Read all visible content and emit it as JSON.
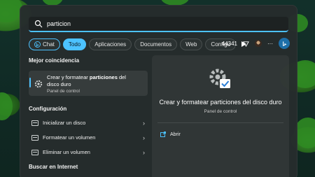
{
  "search": {
    "value": "particion"
  },
  "tabs": [
    {
      "label": "Chat",
      "icon": "bing-icon"
    },
    {
      "label": "Todo",
      "active": true
    },
    {
      "label": "Aplicaciones"
    },
    {
      "label": "Documentos"
    },
    {
      "label": "Web"
    },
    {
      "label": "Configu"
    }
  ],
  "toolbar": {
    "points": "44341",
    "more_label": "···"
  },
  "best_match": {
    "section": "Mejor coincidencia",
    "title_prefix": "Crear y formatear ",
    "title_bold": "particiones",
    "title_suffix": " del disco duro",
    "subtitle": "Panel de control"
  },
  "config": {
    "section": "Configuración",
    "items": [
      {
        "label": "Inicializar un disco"
      },
      {
        "label": "Formatear un volumen"
      },
      {
        "label": "Eliminar un volumen"
      }
    ]
  },
  "internet": {
    "section": "Buscar en Internet"
  },
  "detail": {
    "title": "Crear y formatear particiones del disco duro",
    "subtitle": "Panel de control",
    "open_label": "Abrir"
  },
  "colors": {
    "accent": "#4cc2ff",
    "panel": "#262c2c"
  }
}
